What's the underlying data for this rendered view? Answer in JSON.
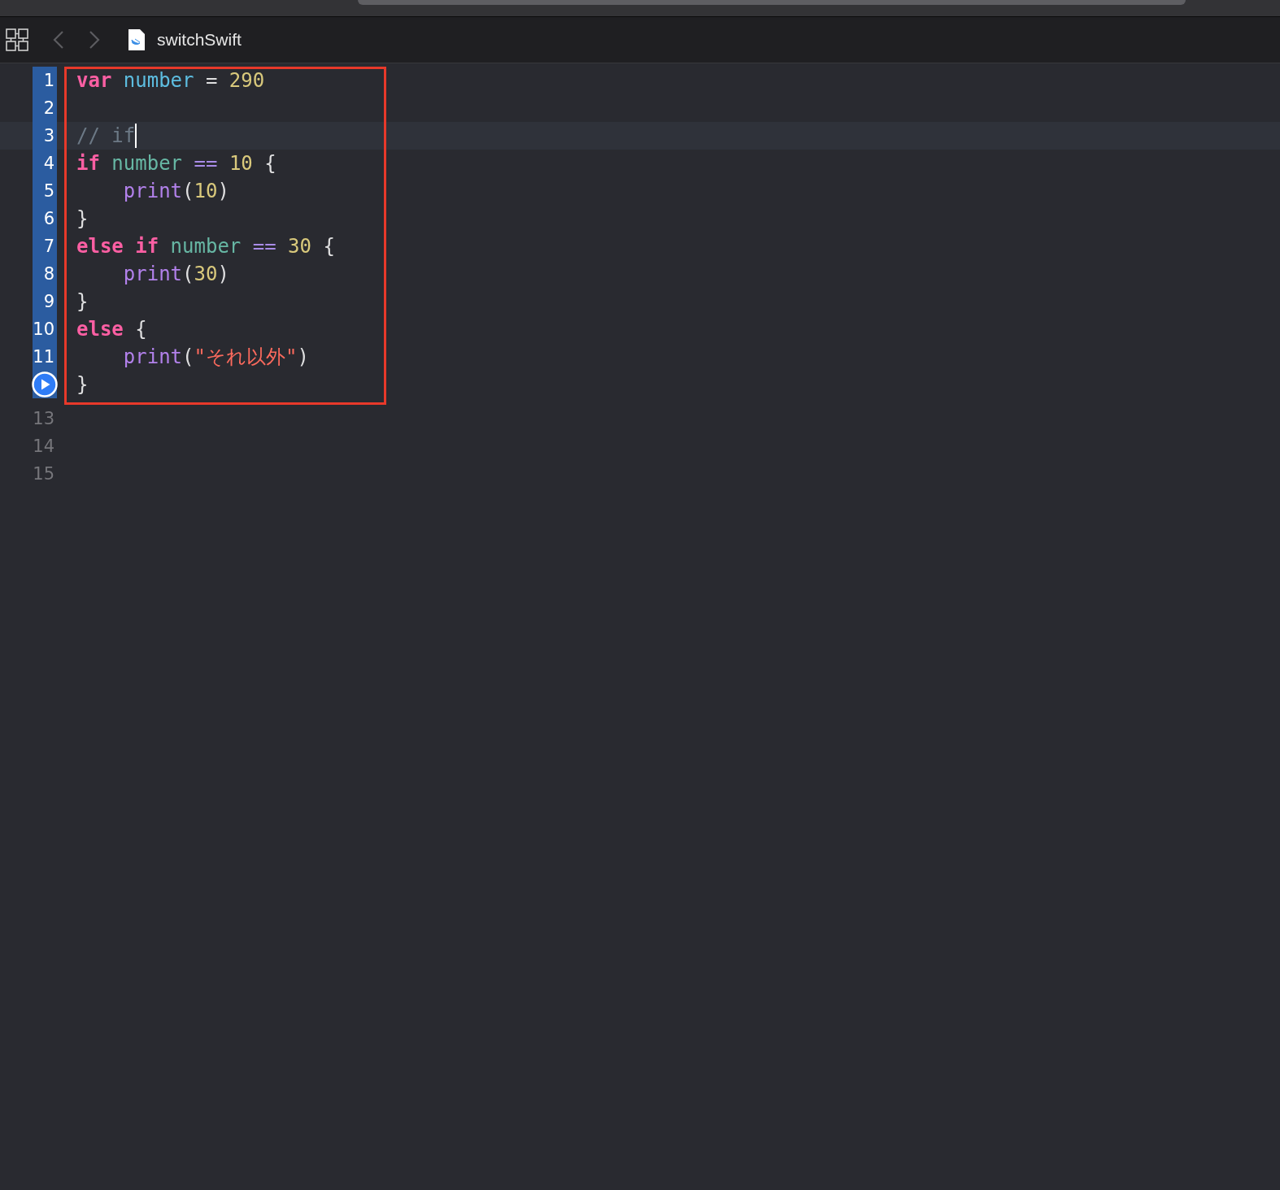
{
  "toolbar": {
    "file_name": "switchSwift"
  },
  "boxed_lines": [
    {
      "kind": "number",
      "number": "1",
      "selected": true,
      "tokens": [
        {
          "kind": "keyword",
          "text": "var "
        },
        {
          "kind": "declaration",
          "text": "number "
        },
        {
          "kind": "plain",
          "text": "= "
        },
        {
          "kind": "literal",
          "text": "290"
        }
      ]
    },
    {
      "kind": "number",
      "number": "2",
      "selected": true
    },
    {
      "kind": "number",
      "number": "3",
      "selected": true,
      "current": true,
      "cursor": true,
      "tokens": [
        {
          "kind": "comment",
          "text": "// if"
        }
      ]
    },
    {
      "kind": "number",
      "number": "4",
      "selected": true,
      "tokens": [
        {
          "kind": "keyword",
          "text": "if "
        },
        {
          "kind": "identifier",
          "text": "number "
        },
        {
          "kind": "operator",
          "text": "== "
        },
        {
          "kind": "literal",
          "text": "10 "
        },
        {
          "kind": "plain",
          "text": "{"
        }
      ]
    },
    {
      "kind": "number",
      "number": "5",
      "selected": true,
      "indent": true,
      "tokens": [
        {
          "kind": "function",
          "text": "print"
        },
        {
          "kind": "plain",
          "text": "("
        },
        {
          "kind": "literal",
          "text": "10"
        },
        {
          "kind": "plain",
          "text": ")"
        }
      ]
    },
    {
      "kind": "number",
      "number": "6",
      "selected": true,
      "tokens": [
        {
          "kind": "plain",
          "text": "}"
        }
      ]
    },
    {
      "kind": "number",
      "number": "7",
      "selected": true,
      "tokens": [
        {
          "kind": "keyword",
          "text": "else if "
        },
        {
          "kind": "identifier",
          "text": "number "
        },
        {
          "kind": "operator",
          "text": "== "
        },
        {
          "kind": "literal",
          "text": "30 "
        },
        {
          "kind": "plain",
          "text": "{"
        }
      ]
    },
    {
      "kind": "number",
      "number": "8",
      "selected": true,
      "indent": true,
      "tokens": [
        {
          "kind": "function",
          "text": "print"
        },
        {
          "kind": "plain",
          "text": "("
        },
        {
          "kind": "literal",
          "text": "30"
        },
        {
          "kind": "plain",
          "text": ")"
        }
      ]
    },
    {
      "kind": "number",
      "number": "9",
      "selected": true,
      "tokens": [
        {
          "kind": "plain",
          "text": "}"
        }
      ]
    },
    {
      "kind": "number",
      "number": "10",
      "selected": true,
      "tokens": [
        {
          "kind": "keyword",
          "text": "else "
        },
        {
          "kind": "plain",
          "text": "{"
        }
      ]
    },
    {
      "kind": "number",
      "number": "11",
      "selected": true,
      "indent": true,
      "tokens": [
        {
          "kind": "function",
          "text": "print"
        },
        {
          "kind": "plain",
          "text": "("
        },
        {
          "kind": "string",
          "text": "\"それ以外\""
        },
        {
          "kind": "plain",
          "text": ")"
        }
      ]
    },
    {
      "kind": "run",
      "selected": true,
      "tokens": [
        {
          "kind": "plain",
          "text": "}"
        }
      ]
    }
  ],
  "lines": [
    {
      "kind": "number",
      "number": "13",
      "selected": false
    },
    {
      "kind": "number",
      "number": "14",
      "selected": false
    },
    {
      "kind": "number",
      "number": "15",
      "selected": false
    }
  ]
}
